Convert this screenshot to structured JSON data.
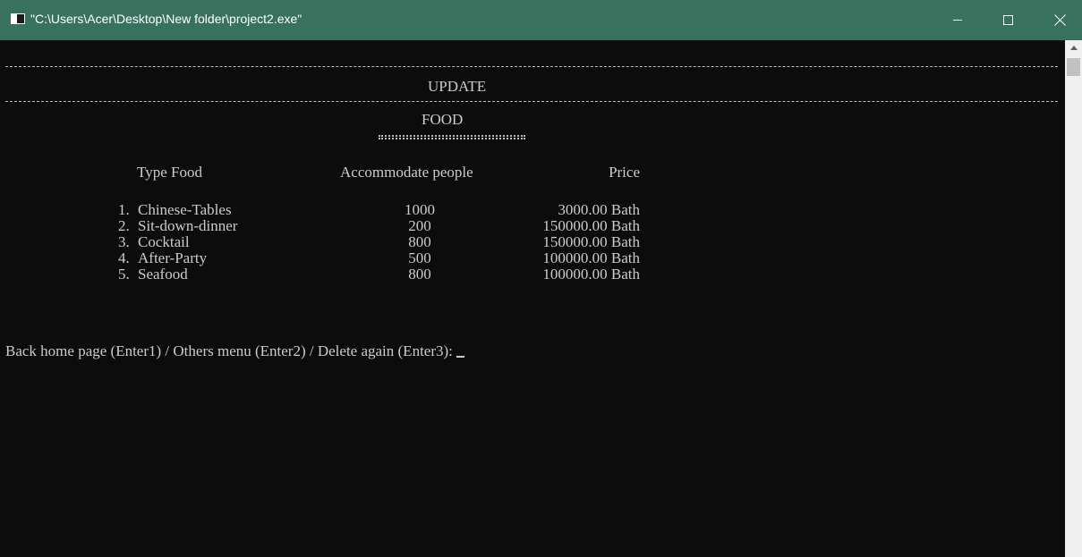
{
  "window": {
    "title": "\"C:\\Users\\Acer\\Desktop\\New folder\\project2.exe\"",
    "icons": {
      "app": "console-app-icon",
      "minimize": "minimize-icon",
      "maximize": "maximize-icon",
      "close": "close-icon"
    }
  },
  "console": {
    "section_title": "UPDATE",
    "subtitle": "FOOD",
    "columns": {
      "type": "Type Food",
      "accommodate": "Accommodate people",
      "price": "Price"
    },
    "rows": [
      {
        "num": "1.",
        "name": "Chinese-Tables",
        "capacity": "1000",
        "price": "3000.00 Bath"
      },
      {
        "num": "2.",
        "name": "Sit-down-dinner",
        "capacity": "200",
        "price": "150000.00 Bath"
      },
      {
        "num": "3.",
        "name": "Cocktail",
        "capacity": "800",
        "price": "150000.00 Bath"
      },
      {
        "num": "4.",
        "name": "After-Party",
        "capacity": "500",
        "price": "100000.00 Bath"
      },
      {
        "num": "5.",
        "name": "Seafood",
        "capacity": "800",
        "price": "100000.00 Bath"
      }
    ],
    "prompt": "Back home page (Enter1) / Others menu (Enter2) / Delete again (Enter3):"
  },
  "colors": {
    "titlebar": "#38725f",
    "background": "#0c0c0c",
    "text": "#cccccc"
  }
}
